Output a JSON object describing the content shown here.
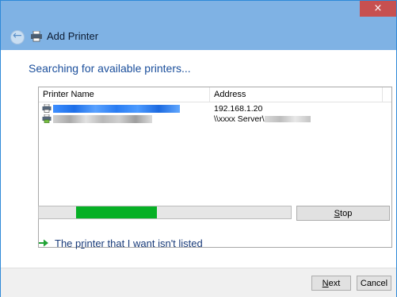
{
  "window": {
    "close_glyph": "×",
    "title": "Add Printer"
  },
  "main": {
    "heading": "Searching for available printers...",
    "columns": [
      "Printer Name",
      "Address"
    ],
    "rows": [
      {
        "name_redacted": true,
        "selected": true,
        "address": "192.168.1.20"
      },
      {
        "name_redacted": true,
        "selected": false,
        "address_prefix": "\\\\xxxx Server\\",
        "address_redacted": true
      }
    ],
    "progress_fraction": 0.32,
    "stop_label_pre": "",
    "stop_label_accel": "S",
    "stop_label_post": "top",
    "link_pre": "The p",
    "link_accel": "r",
    "link_post": "inter that I want isn't listed"
  },
  "footer": {
    "next_accel": "N",
    "next_rest": "ext",
    "cancel_label": "Cancel"
  },
  "colors": {
    "titlebar": "#7fb2e4",
    "close": "#c75050",
    "heading": "#1a4e9b",
    "progress": "#06b025",
    "selection": "#3399ff"
  },
  "icons": [
    "back-arrow-icon",
    "printer-icon",
    "green-arrow-icon"
  ]
}
